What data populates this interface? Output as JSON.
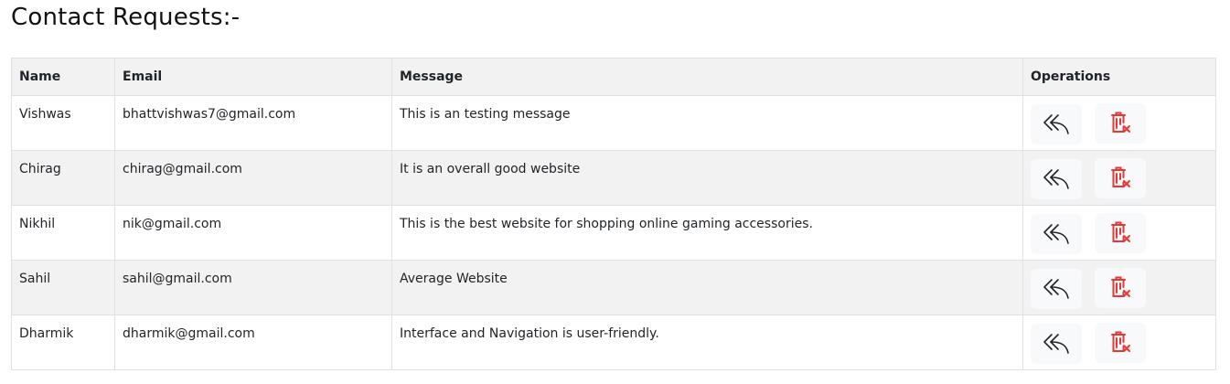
{
  "page": {
    "title": "Contact Requests:-"
  },
  "table": {
    "headers": {
      "name": "Name",
      "email": "Email",
      "message": "Message",
      "operations": "Operations"
    },
    "rows": [
      {
        "name": "Vishwas",
        "email": "bhattvishwas7@gmail.com",
        "message": "This is an testing message"
      },
      {
        "name": "Chirag",
        "email": "chirag@gmail.com",
        "message": "It is an overall good website"
      },
      {
        "name": "Nikhil",
        "email": "nik@gmail.com",
        "message": "This is the best website for shopping online gaming accessories."
      },
      {
        "name": "Sahil",
        "email": "sahil@gmail.com",
        "message": "Average Website"
      },
      {
        "name": "Dharmik",
        "email": "dharmik@gmail.com",
        "message": "Interface and Navigation is user-friendly."
      }
    ],
    "operations": {
      "reply_icon": "reply-icon",
      "delete_icon": "trash-x-icon",
      "delete_color": "#e53935",
      "reply_color": "#222222"
    }
  }
}
